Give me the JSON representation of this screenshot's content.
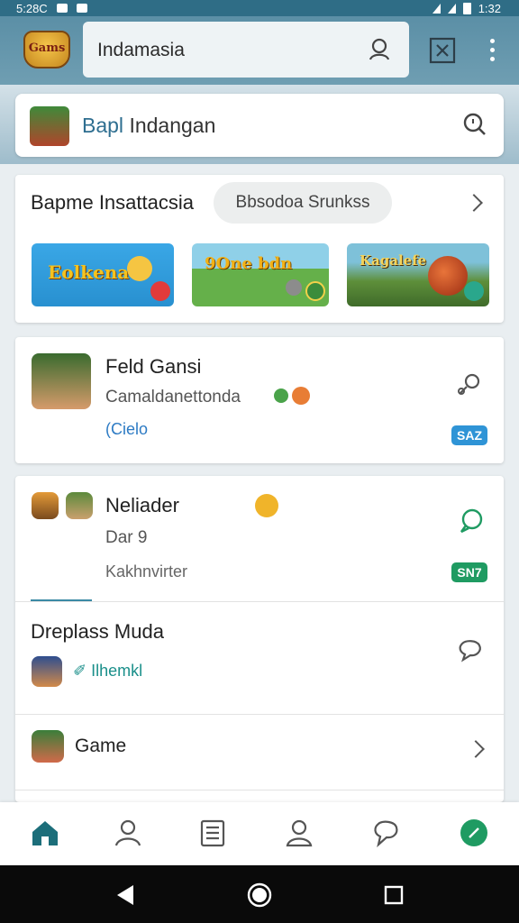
{
  "status_bar": {
    "left_text": "5:28C",
    "right_text": "1:32"
  },
  "app_bar": {
    "logo_text": "Gams",
    "search_value": "Indamasia",
    "icons": [
      "search-icon",
      "close-box-icon",
      "more-vert-icon"
    ]
  },
  "secondary_search": {
    "value_prefix": "Bapl",
    "value_rest": "Indangan",
    "icons": [
      "search-icon"
    ]
  },
  "featured": {
    "title": "Bapme Insattacsia",
    "chip_label": "Bbsodoa Srunkss",
    "banners": [
      {
        "text": "Eolkena"
      },
      {
        "text": "9One bdn"
      },
      {
        "text": "Kagalefe"
      }
    ]
  },
  "app_card": {
    "name": "Feld Gansi",
    "subtitle": "Camaldanettonda",
    "link": "(Cielo",
    "pill": "SAZ"
  },
  "list_card": {
    "item1": {
      "name": "Neliader",
      "sub1": "Dar 9",
      "sub2": "Kakhnvirter",
      "pill": "SN7"
    },
    "item2": {
      "name": "Dreplass Muda",
      "link": "Ilhemkl"
    },
    "item3": {
      "name": "Game"
    }
  },
  "bottom_nav": [
    "home-icon",
    "profile-icon",
    "list-icon",
    "account-icon",
    "chat-icon",
    "compass-icon"
  ],
  "colors": {
    "app_bar": "#5b8fa6",
    "accent_blue": "#2f94d6",
    "accent_green": "#1f9b62",
    "home_active": "#1c6e7a"
  }
}
